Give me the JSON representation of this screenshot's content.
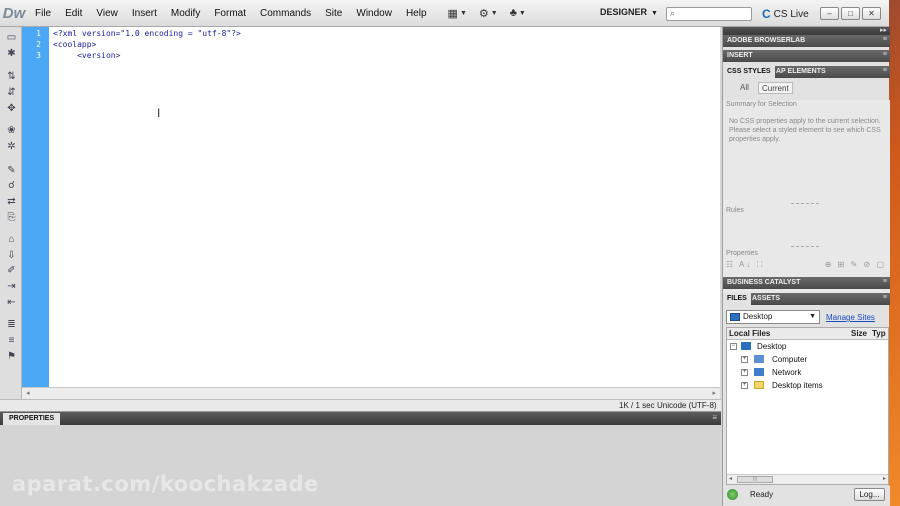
{
  "app": {
    "logo": "Dw"
  },
  "menu": {
    "items": [
      "File",
      "Edit",
      "View",
      "Insert",
      "Modify",
      "Format",
      "Commands",
      "Site",
      "Window",
      "Help"
    ]
  },
  "toolbar": {
    "workspace": "DESIGNER",
    "search_placeholder": "",
    "cslive": "CS Live"
  },
  "editor": {
    "line_numbers": [
      "1",
      "2",
      "3"
    ],
    "lines": [
      "<?xml version=\"1.0 encoding = \"utf-8\"?>",
      "<coolapp>",
      "     <version>"
    ]
  },
  "status": {
    "size": "1K / 1 sec",
    "encoding": "Unicode (UTF-8)"
  },
  "properties": {
    "title": "PROPERTIES"
  },
  "panels": {
    "browserlab": "ADOBE BROWSERLAB",
    "insert": "INSERT",
    "css_tabs": [
      "CSS STYLES",
      "AP ELEMENTS"
    ],
    "css_modes": [
      "All",
      "Current"
    ],
    "summary_title": "Summary for Selection",
    "summary_msg": "No CSS properties apply to the current selection.  Please select a styled element to see which CSS properties apply.",
    "rules": "Rules",
    "properties": "Properties",
    "business_catalyst": "BUSINESS CATALYST",
    "file_tabs": [
      "FILES",
      "ASSETS"
    ],
    "site": "Desktop",
    "manage_sites": "Manage Sites",
    "columns": [
      "Local Files",
      "Size",
      "Typ"
    ],
    "tree": [
      {
        "label": "Desktop",
        "toggle": "−"
      },
      {
        "label": "Computer",
        "toggle": "+"
      },
      {
        "label": "Network",
        "toggle": "+"
      },
      {
        "label": "Desktop items",
        "toggle": "+"
      }
    ],
    "ready": "Ready",
    "log_button": "Log..."
  },
  "watermark": "aparat.com/koochakzade",
  "colors": {
    "gutter": "#4aa8f5",
    "code_text": "#1b1b9a",
    "link": "#1a4bc9"
  }
}
